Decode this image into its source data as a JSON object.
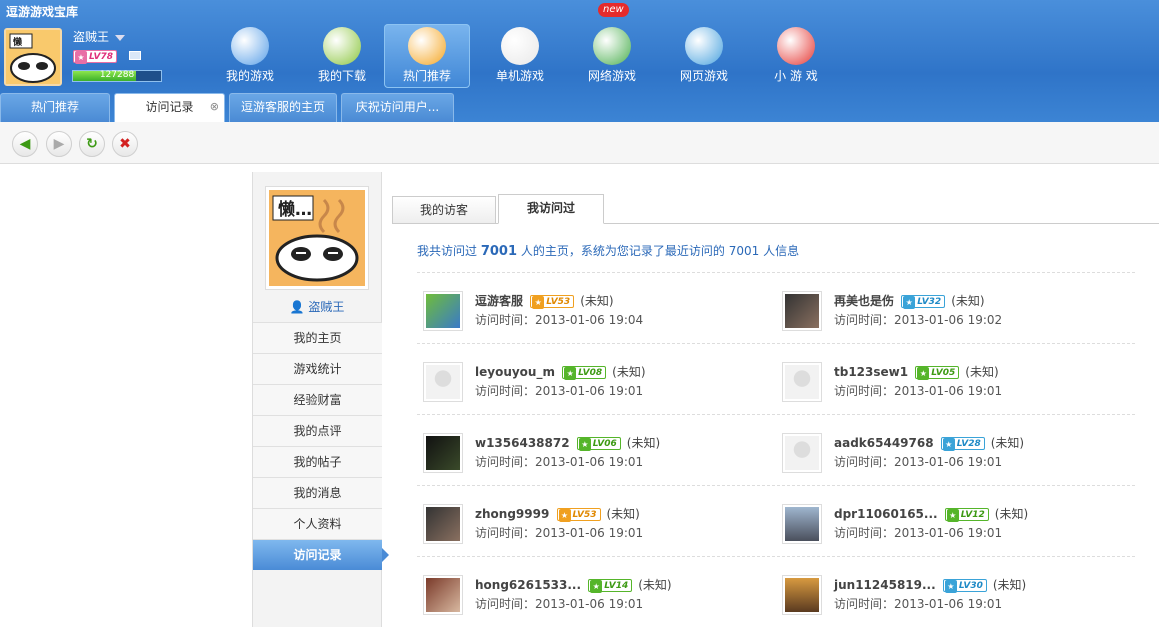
{
  "app": {
    "title": "逗游游戏宝库"
  },
  "user": {
    "name": "盗贼王",
    "level": "LV78",
    "xp_text": "127288",
    "xp_fraction": 0.72
  },
  "nav": [
    {
      "label": "我的游戏",
      "icon": "user-globe-icon",
      "color": "#5aa0e8"
    },
    {
      "label": "我的下载",
      "icon": "gear-download-icon",
      "color": "#8cc63f"
    },
    {
      "label": "热门推荐",
      "icon": "disc-plus-icon",
      "color": "#f5a623"
    },
    {
      "label": "单机游戏",
      "icon": "gamepad-icon",
      "color": "#e8e8e8"
    },
    {
      "label": "网络游戏",
      "icon": "globe-sword-icon",
      "color": "#4caf50"
    },
    {
      "label": "网页游戏",
      "icon": "browser-icon",
      "color": "#4aa3df"
    },
    {
      "label": "小 游 戏",
      "icon": "joystick-icon",
      "color": "#e53935"
    }
  ],
  "nav_new_badge": "new",
  "tabs": [
    {
      "label": "热门推荐"
    },
    {
      "label": "访问记录"
    },
    {
      "label": "逗游客服的主页"
    },
    {
      "label": "庆祝访问用户..."
    }
  ],
  "toolbar": {
    "back": "back-arrow-icon",
    "forward": "forward-arrow-icon",
    "refresh": "refresh-icon",
    "stop": "stop-icon"
  },
  "sidebar": {
    "name": "盗贼王",
    "menu": [
      "我的主页",
      "游戏统计",
      "经验财富",
      "我的点评",
      "我的帖子",
      "我的消息",
      "个人资料",
      "访问记录"
    ]
  },
  "main": {
    "tabs": [
      "我的访客",
      "我访问过"
    ],
    "summary_prefix": "我共访问过",
    "summary_count": "7001",
    "summary_mid": "人的主页，系统为您记录了最近访问的",
    "summary_count2": "7001",
    "summary_suffix": "人信息",
    "unknown": "(未知)",
    "time_prefix": "访问时间：",
    "visits": [
      {
        "name": "逗游客服",
        "level": "LV53",
        "color": "orange",
        "time": "2013-01-06 19:04",
        "thumb": "gift"
      },
      {
        "name": "再美也是伤",
        "level": "LV32",
        "color": "blue",
        "time": "2013-01-06 19:02",
        "thumb": "photo"
      },
      {
        "name": "leyouyou_m",
        "level": "LV08",
        "color": "green",
        "time": "2013-01-06 19:01",
        "thumb": "default"
      },
      {
        "name": "tb123sew1",
        "level": "LV05",
        "color": "green",
        "time": "2013-01-06 19:01",
        "thumb": "default"
      },
      {
        "name": "w1356438872",
        "level": "LV06",
        "color": "green",
        "time": "2013-01-06 19:01",
        "thumb": "dark"
      },
      {
        "name": "aadk65449768",
        "level": "LV28",
        "color": "blue",
        "time": "2013-01-06 19:01",
        "thumb": "default"
      },
      {
        "name": "zhong9999",
        "level": "LV53",
        "color": "orange",
        "time": "2013-01-06 19:01",
        "thumb": "photo"
      },
      {
        "name": "dpr11060165...",
        "level": "LV12",
        "color": "green",
        "time": "2013-01-06 19:01",
        "thumb": "photo2"
      },
      {
        "name": "hong6261533...",
        "level": "LV14",
        "color": "green",
        "time": "2013-01-06 19:01",
        "thumb": "photo3"
      },
      {
        "name": "jun11245819...",
        "level": "LV30",
        "color": "blue",
        "time": "2013-01-06 19:01",
        "thumb": "sunset"
      }
    ]
  }
}
